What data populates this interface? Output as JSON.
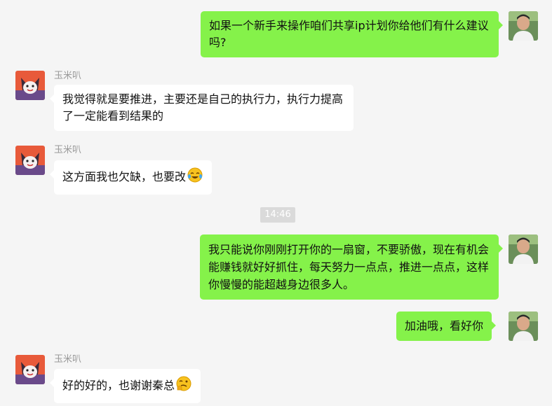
{
  "contact": {
    "name": "玉米叭"
  },
  "messages": [
    {
      "from": "me",
      "text": "如果一个新手来操作咱们共享ip计划你给他们有什么建议吗?"
    },
    {
      "from": "other",
      "sender": "玉米叭",
      "text": "我觉得就是要推进，主要还是自己的执行力，执行力提高了一定能看到结果的"
    },
    {
      "from": "other",
      "sender": "玉米叭",
      "text": "这方面我也欠缺，也要改",
      "emoji": "laughing-tears-emoji"
    },
    {
      "type": "time",
      "text": "14:46"
    },
    {
      "from": "me",
      "text": "我只能说你刚刚打开你的一扇窗，不要骄傲，现在有机会能赚钱就好好抓住，每天努力一点点，推进一点点，这样你慢慢的能超越身边很多人。"
    },
    {
      "from": "me",
      "text": "加油哦，看好你"
    },
    {
      "from": "other",
      "sender": "玉米叭",
      "text": "好的好的，也谢谢秦总",
      "emoji": "thinking-smirk-emoji"
    }
  ],
  "colors": {
    "my_bubble": "#85f24a",
    "other_bubble": "#ffffff",
    "background": "#f5f5f5",
    "name": "#999999"
  }
}
